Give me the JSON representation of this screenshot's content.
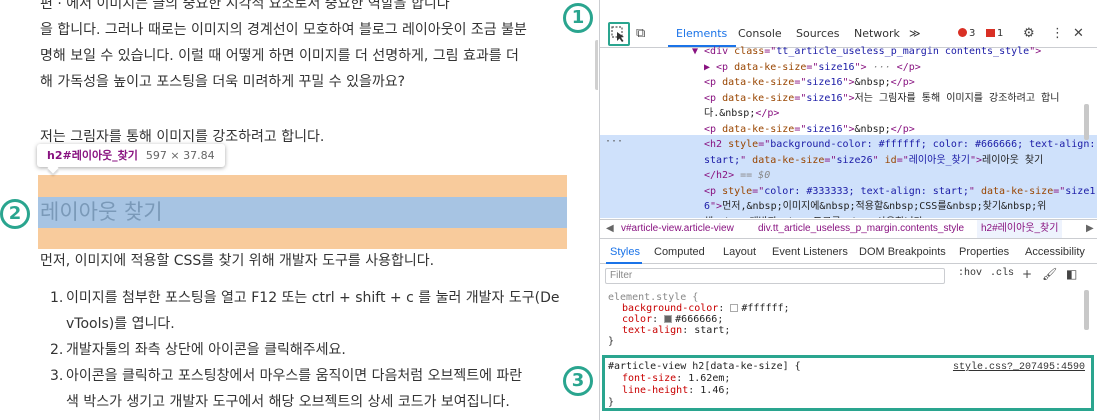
{
  "blog": {
    "para1_lines": [
      "편 · 에서 이미지는 글의 중요한 시각적 요소로서 중요한 역할을 합니다",
      "을 합니다. 그러나 때로는 이미지의 경계선이 모호하여 블로그 레이아웃이 조금 불분",
      "명해 보일 수 있습니다. 이럴 때 어떻게 하면 이미지를 더 선명하게, 그림 효과를 더",
      "해 가독성을 높이고 포스팅을 더욱 미려하게 꾸밀 수 있을까요?"
    ],
    "para2": "저는 그림자를 통해 이미지를 강조하려고 합니다.",
    "tooltip_selector": "h2#레이아웃_찾기",
    "tooltip_dims": "597 × 37.84",
    "heading": "레이아웃 찾기",
    "para3": "먼저, 이미지에 적용할 CSS를 찾기 위해 개발자 도구를 사용합니다.",
    "steps": [
      {
        "num": "1.",
        "lines": [
          "이미지를 첨부한 포스팅을 열고 F12 또는 ctrl + shift + c 를 눌러 개발자 도구(De",
          "vTools)를 엽니다."
        ]
      },
      {
        "num": "2.",
        "lines": [
          "개발자툴의 좌측 상단에 아이콘을 클릭해주세요."
        ]
      },
      {
        "num": "3.",
        "lines": [
          "아이콘을 클릭하고 포스팅창에서 마우스를 움직이면 다음처럼 오브젝트에 파란",
          "색 박스가 생기고 개발자 도구에서 해당 오브젝트의 상세 코드가 보여집니다."
        ]
      }
    ]
  },
  "badges": [
    "1",
    "2",
    "3"
  ],
  "devtools": {
    "tabs": [
      "Elements",
      "Console",
      "Sources",
      "Network"
    ],
    "more": "≫",
    "error_count": "3",
    "warn_count": "1",
    "dom_lines": [
      {
        "indent": 0,
        "parts": [
          [
            "tag",
            "▼ <div "
          ],
          [
            "attr",
            "class"
          ],
          [
            "tag",
            "=\""
          ],
          [
            "val",
            "tt_article_useless_p_margin contents_style"
          ],
          [
            "tag",
            "\">"
          ]
        ]
      },
      {
        "indent": 1,
        "parts": [
          [
            "tag",
            "▶ <p "
          ],
          [
            "attr",
            "data-ke-size"
          ],
          [
            "tag",
            "=\""
          ],
          [
            "val",
            "size16"
          ],
          [
            "tag",
            "\"> "
          ],
          [
            "dim",
            "···"
          ],
          [
            "tag",
            " </p>"
          ]
        ]
      },
      {
        "indent": 1,
        "parts": [
          [
            "tag",
            "<p "
          ],
          [
            "attr",
            "data-ke-size"
          ],
          [
            "tag",
            "=\""
          ],
          [
            "val",
            "size16"
          ],
          [
            "tag",
            "\">"
          ],
          [
            "txt",
            "&nbsp;"
          ],
          [
            "tag",
            "</p>"
          ]
        ]
      },
      {
        "indent": 1,
        "parts": [
          [
            "tag",
            "<p "
          ],
          [
            "attr",
            "data-ke-size"
          ],
          [
            "tag",
            "=\""
          ],
          [
            "val",
            "size16"
          ],
          [
            "tag",
            "\">"
          ],
          [
            "txt",
            "저는 그림자를 통해 이미지를 강조하려고 합니"
          ]
        ]
      },
      {
        "indent": 1,
        "parts": [
          [
            "txt",
            "다.&nbsp;"
          ],
          [
            "tag",
            "</p>"
          ]
        ]
      },
      {
        "indent": 1,
        "parts": [
          [
            "tag",
            "<p "
          ],
          [
            "attr",
            "data-ke-size"
          ],
          [
            "tag",
            "=\""
          ],
          [
            "val",
            "size16"
          ],
          [
            "tag",
            "\">"
          ],
          [
            "txt",
            "&nbsp;"
          ],
          [
            "tag",
            "</p>"
          ]
        ]
      },
      {
        "indent": 1,
        "parts": [
          [
            "tag",
            "<h2 "
          ],
          [
            "attr",
            "style"
          ],
          [
            "tag",
            "=\""
          ],
          [
            "val",
            "background-color: #ffffff; color: #666666; text-align:"
          ]
        ]
      },
      {
        "indent": 1,
        "parts": [
          [
            "val",
            "start;"
          ],
          [
            "tag",
            "\" "
          ],
          [
            "attr",
            "data-ke-size"
          ],
          [
            "tag",
            "=\""
          ],
          [
            "val",
            "size26"
          ],
          [
            "tag",
            "\" "
          ],
          [
            "attr",
            "id"
          ],
          [
            "tag",
            "=\""
          ],
          [
            "val",
            "레이아웃_찾기"
          ],
          [
            "tag",
            "\">"
          ],
          [
            "txt",
            "레이아웃 찾기"
          ]
        ]
      },
      {
        "indent": 1,
        "parts": [
          [
            "tag",
            "</h2> "
          ],
          [
            "dim",
            "== $0"
          ]
        ]
      },
      {
        "indent": 1,
        "parts": [
          [
            "tag",
            "<p "
          ],
          [
            "attr",
            "style"
          ],
          [
            "tag",
            "=\""
          ],
          [
            "val",
            "color: #333333; text-align: start;"
          ],
          [
            "tag",
            "\" "
          ],
          [
            "attr",
            "data-ke-size"
          ],
          [
            "tag",
            "=\""
          ],
          [
            "val",
            "size1"
          ]
        ]
      },
      {
        "indent": 1,
        "parts": [
          [
            "val",
            "6"
          ],
          [
            "tag",
            "\">"
          ],
          [
            "txt",
            "먼저,&nbsp;이미지에&nbsp;적용할&nbsp;CSS를&nbsp;찾기&nbsp;위"
          ]
        ]
      },
      {
        "indent": 1,
        "parts": [
          [
            "txt",
            "해&nbsp;개발자&nbsp;도구를&nbsp;사용합니다."
          ],
          [
            "tag",
            "</p>"
          ]
        ]
      }
    ],
    "breadcrumb": [
      "◀",
      "v#article-view.article-view",
      "div.tt_article_useless_p_margin.contents_style",
      "h2#레이아웃_찾기",
      "▶"
    ],
    "sub_tabs": [
      "Styles",
      "Computed",
      "Layout",
      "Event Listeners",
      "DOM Breakpoints",
      "Properties",
      "Accessibility"
    ],
    "filter_placeholder": "Filter",
    "hov": ":hov",
    "cls": ".cls",
    "element_style": {
      "selector": "element.style {",
      "props": [
        {
          "name": "background-color",
          "value": "#ffffff",
          "swatch": "#ffffff"
        },
        {
          "name": "color",
          "value": "#666666",
          "swatch": "#666666"
        },
        {
          "name": "text-align",
          "value": "start",
          "swatch": ""
        }
      ],
      "close": "}"
    },
    "rule": {
      "selector": "#article-view h2[data-ke-size] {",
      "source": "style.css?_207495:4590",
      "props": [
        {
          "name": "font-size",
          "value": "1.62em"
        },
        {
          "name": "line-height",
          "value": "1.46"
        }
      ],
      "close": "}"
    }
  },
  "colors": {
    "accent": "#2aa58f",
    "devtools_blue": "#1a73e8",
    "highlight_padding": "#f8cb9c",
    "highlight_content": "#a7c4e3"
  }
}
